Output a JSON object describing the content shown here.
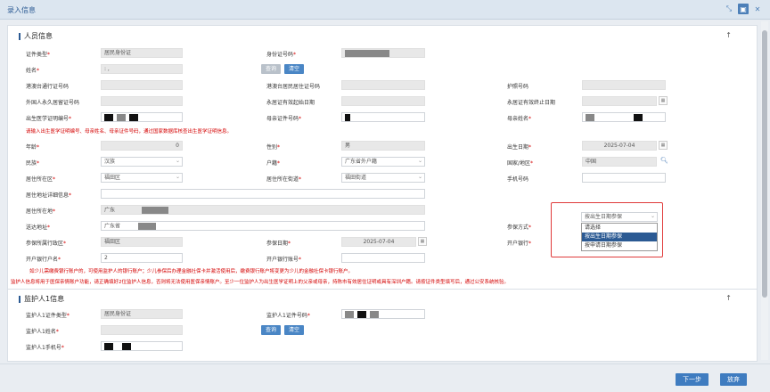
{
  "window": {
    "title": "录入信息"
  },
  "section1": {
    "title": "人员信息"
  },
  "section2": {
    "title": "监护人1信息"
  },
  "fields": {
    "id_type_label": "证件类型",
    "id_type_value": "居民身份证",
    "id_no_label": "身份证号码",
    "name_label": "姓名",
    "name_value": ": ,",
    "query_label": "查询",
    "clear_label": "清空",
    "hk_pass_label": "港澳台通行证号码",
    "hk_res_label": "港澳台居民居住证号码",
    "passport_label": "护照号码",
    "foreign_pr_label": "外国人永久居留证号码",
    "pr_start_label": "永居证有效起始日期",
    "pr_end_label": "永居证有效终止日期",
    "birth_cert_label": "出生医学证明编号",
    "mother_id_label": "母亲证件号码",
    "mother_name_label": "母亲姓名",
    "birth_warning": "请输入出生医学证明编号、母亲姓名、母亲证件号码，通过国家数据库核查出生医学证明信息。",
    "age_label": "年龄",
    "age_value": "0",
    "gender_label": "性别",
    "gender_value": "男",
    "birth_date_label": "出生日期",
    "birth_date_value": "2025-07-04",
    "ethnic_label": "民族",
    "ethnic_value": "汉族",
    "hukou_label": "户籍",
    "hukou_value": "广东省外户籍",
    "country_label": "国家/地区",
    "country_value": "中国",
    "district_label": "居住所在区",
    "district_value": "福田区",
    "street_label": "居住所在街道",
    "street_value": "福田街道",
    "mobile_label": "手机号码",
    "address_detail_label": "居住地址详细信息",
    "location_label": "居住所在地",
    "location_value": "广东",
    "mail_label": "送达地址",
    "mail_value": "广东省",
    "insure_mode_label": "参保方式",
    "insure_district_label": "参保所属行政区",
    "insure_district_value": "福田区",
    "insure_date_label": "参保日期",
    "insure_date_value": "2025-07-04",
    "bank_label": "开户银行",
    "account_name_label": "开户银行户名",
    "account_name_value": "2",
    "account_no_label": "开户银行账号",
    "bank_note": "如少儿需缴费银行账户的，可使用监护人的银行账户；少儿参保后办理金融社保卡并激活使用后，缴费银行账户将变更为少儿的金融社保卡银行账户。",
    "guardian_note": "监护人信息将用于医保亲情账户功能，请正确填好2位监护人信息，否则将无法使用医保亲情账户。至少一位监护人为出生医学证明上的父亲或母亲，持陈市有效居住证明或具有深圳户籍。请按证件类型填写后，通过公安系统核验。",
    "g1_id_type_label": "监护人1证件类型",
    "g1_id_type_value": "居民身份证",
    "g1_id_no_label": "监护人1证件号码",
    "g1_name_label": "监护人1姓名",
    "g1_mobile_label": "监护人1手机号"
  },
  "insure_dropdown": {
    "selected": "按出生日期参保",
    "options": [
      "请选择",
      "按出生日期参保",
      "按申请日期参保"
    ],
    "highlighted_index": 1
  },
  "footer": {
    "next_label": "下一步",
    "abandon_label": "放弃"
  },
  "colors": {
    "accent": "#2b5a93",
    "button": "#4a86c5",
    "warning": "#d40000",
    "highlight_frame": "#e03a3a"
  }
}
